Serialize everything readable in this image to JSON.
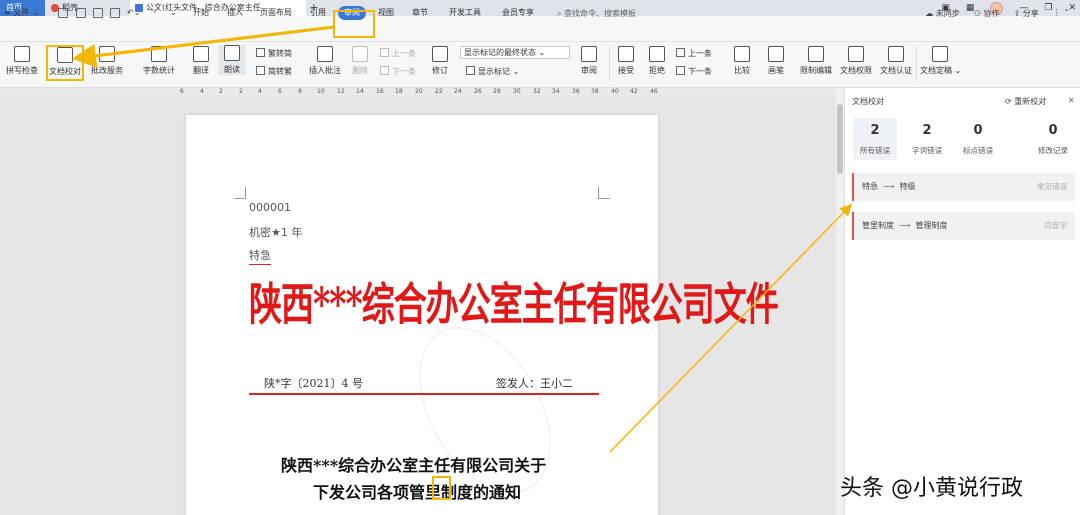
{
  "tabs": {
    "home": "首页",
    "draft": "稻壳",
    "doc": "公文(红头文件...综合办公室主任",
    "new_tab": "+"
  },
  "menu": {
    "file": "文件",
    "items": [
      "开始",
      "插入",
      "页面布局",
      "引用",
      "审阅",
      "视图",
      "章节",
      "开发工具",
      "会员专享"
    ],
    "active_index": 4,
    "search_placeholder": "查找命令、搜索模板",
    "right": [
      "未同步",
      "协作",
      "分享"
    ]
  },
  "ribbon": {
    "spellcheck": "拼写检查",
    "proofread": "文档校对",
    "batch": "批改服务",
    "wordcount": "字数统计",
    "translate": "翻译",
    "readaloud": "朗读",
    "trad": "繁转简",
    "simp": "简转繁",
    "insert_comment": "插入批注",
    "delete": "删除",
    "prev": "上一条",
    "next": "下一条",
    "markup_select": "显示标记的最终状态",
    "revise": "修订",
    "show_markup": "显示标记",
    "review": "审阅",
    "accept": "接受",
    "reject": "拒绝",
    "prev2": "上一条",
    "next2": "下一条",
    "compare": "比较",
    "ink": "画笔",
    "restrict": "限制编辑",
    "permission": "文档权限",
    "certify": "文档认证",
    "finalize": "文档定稿"
  },
  "ruler": [
    "6",
    "4",
    "2",
    "2",
    "4",
    "6",
    "8",
    "10",
    "12",
    "14",
    "16",
    "18",
    "20",
    "22",
    "24",
    "26",
    "28",
    "30",
    "32",
    "34",
    "36",
    "38",
    "40",
    "42",
    "46"
  ],
  "document": {
    "serial": "000001",
    "secret": "机密★1 年",
    "urgency": "特急",
    "red_header": "陕西***综合办公室主任有限公司文件",
    "doc_number": "陕*字〔2021〕4 号",
    "signer": "签发人：王小二",
    "title_line1": "陕西***综合办公室主任有限公司关于",
    "title_line2": "下发公司各项管里制度的通知"
  },
  "panel": {
    "title": "文档校对",
    "recheck": "重新校对",
    "stats": [
      {
        "num": "2",
        "label": "所有错误"
      },
      {
        "num": "2",
        "label": "字词错误"
      },
      {
        "num": "0",
        "label": "标点错误"
      },
      {
        "num": "0",
        "label": "修改记录"
      }
    ],
    "errors": [
      {
        "from": "特急",
        "to": "特级",
        "type": "常见错误"
      },
      {
        "from": "管里制度",
        "to": "管理制度",
        "type": "同音字"
      }
    ]
  },
  "credit": "头条 @小黄说行政",
  "colors": {
    "accent": "#3a78d6",
    "highlight": "#f2b705",
    "red_header": "#e01818"
  }
}
